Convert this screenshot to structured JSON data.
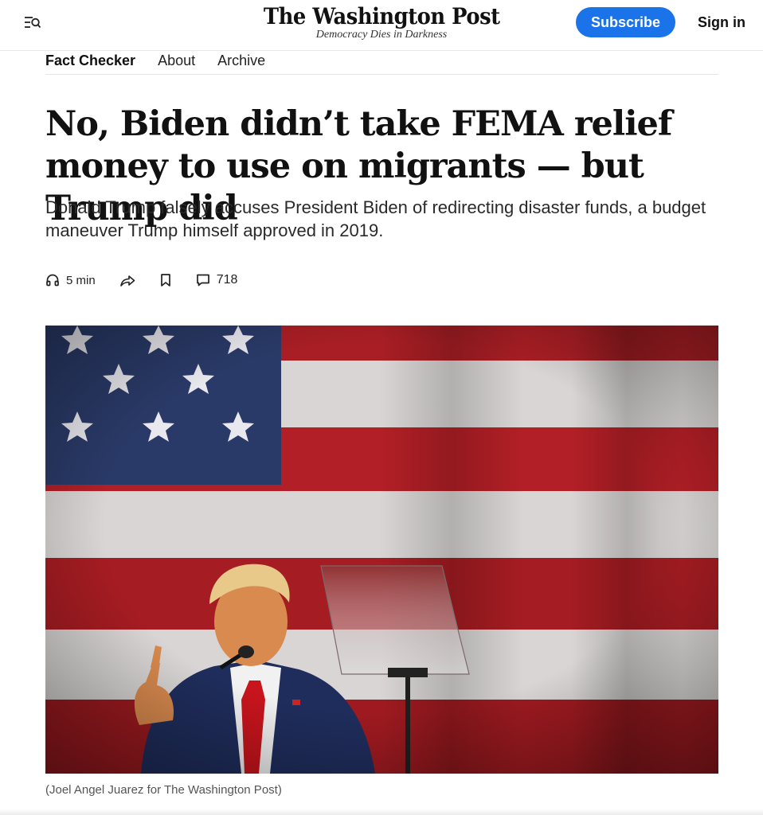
{
  "header": {
    "logo_title": "The Washington Post",
    "logo_tagline": "Democracy Dies in Darkness",
    "subscribe_label": "Subscribe",
    "signin_label": "Sign in",
    "menu_icon": "menu-search-icon",
    "accent_color": "#1a73e8"
  },
  "section_nav": {
    "items": [
      {
        "label": "Fact Checker"
      },
      {
        "label": "About"
      },
      {
        "label": "Archive"
      }
    ]
  },
  "article": {
    "headline": "No, Biden didn’t take FEMA relief money to use on migrants — but Trump did",
    "dek": "Donald Trump falsely accuses President Biden of redirecting disaster funds, a budget maneuver Trump himself approved in 2019.",
    "listen_label": "5 min",
    "comment_count": "718",
    "image_caption": "(Joel Angel Juarez for The Washington Post)"
  },
  "icons": {
    "listen": "headphones-icon",
    "share": "share-icon",
    "save": "bookmark-icon",
    "comments": "comment-icon"
  }
}
